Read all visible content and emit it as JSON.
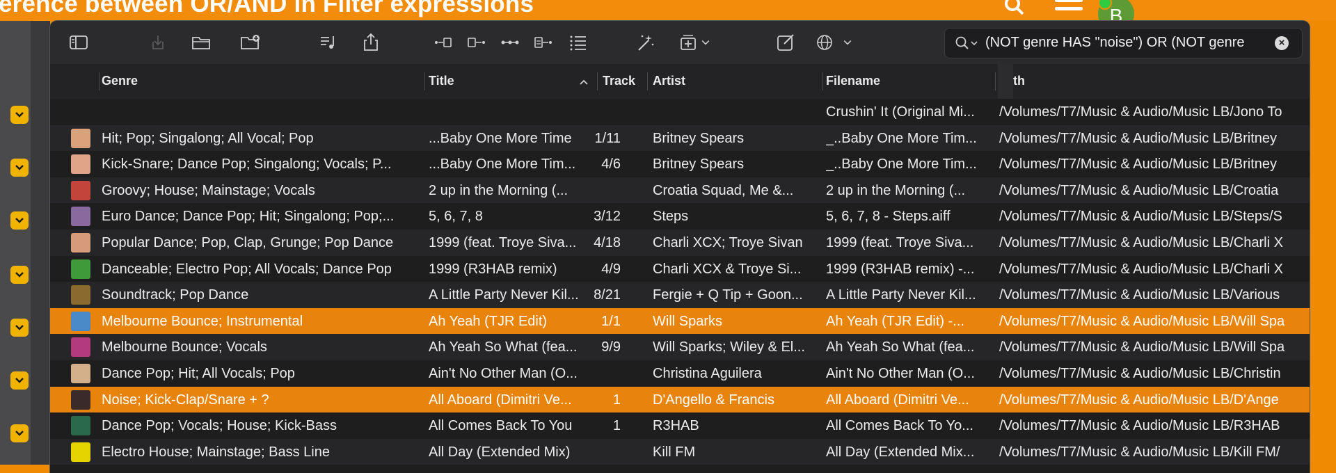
{
  "page": {
    "title": "erence between OR/AND in Filter expressions",
    "avatar_letter": "B"
  },
  "search": {
    "value": "(NOT genre HAS \"noise\") OR (NOT genre",
    "clear": "×"
  },
  "columns": {
    "genre": "Genre",
    "title": "Title",
    "track": "Track",
    "artist": "Artist",
    "filename": "Filename",
    "path": "th"
  },
  "rows": [
    {
      "genre": "",
      "title": "",
      "track": "",
      "artist": "",
      "filename": "Crushin' It (Original Mi...",
      "path": "/Volumes/T7/Music & Audio/Music LB/Jono To",
      "thumb": "",
      "style": "base"
    },
    {
      "genre": "Hit; Pop; Singalong; All Vocal; Pop",
      "title": "...Baby One More Time",
      "track": "1/11",
      "artist": "Britney Spears",
      "filename": "_..Baby One More Tim...",
      "path": "/Volumes/T7/Music & Audio/Music LB/Britney",
      "thumb": "#d9a27a",
      "style": "alt"
    },
    {
      "genre": "Kick-Snare; Dance Pop; Singalong; Vocals; P...",
      "title": "...Baby One More Tim...",
      "track": "4/6",
      "artist": "Britney Spears",
      "filename": "_..Baby One More Tim...",
      "path": "/Volumes/T7/Music & Audio/Music LB/Britney",
      "thumb": "#e0a488",
      "style": "base"
    },
    {
      "genre": "Groovy; House; Mainstage; Vocals",
      "title": "2 up in the Morning (...",
      "track": "",
      "artist": "Croatia Squad, Me &...",
      "filename": "2 up in the Morning (...",
      "path": "/Volumes/T7/Music & Audio/Music LB/Croatia",
      "thumb": "#c2443a",
      "style": "alt"
    },
    {
      "genre": "Euro Dance; Dance Pop; Hit; Singalong; Pop;...",
      "title": "5, 6, 7, 8",
      "track": "3/12",
      "artist": "Steps",
      "filename": "5, 6, 7, 8 - Steps.aiff",
      "path": "/Volumes/T7/Music & Audio/Music LB/Steps/S",
      "thumb": "#8a6a9e",
      "style": "base"
    },
    {
      "genre": "Popular Dance; Pop, Clap, Grunge; Pop Dance",
      "title": "1999 (feat. Troye Siva...",
      "track": "4/18",
      "artist": "Charli XCX; Troye Sivan",
      "filename": "1999 (feat. Troye Siva...",
      "path": "/Volumes/T7/Music & Audio/Music LB/Charli X",
      "thumb": "#d79a7a",
      "style": "alt"
    },
    {
      "genre": "Danceable; Electro Pop; All Vocals; Dance Pop",
      "title": "1999 (R3HAB remix)",
      "track": "4/9",
      "artist": "Charli XCX & Troye Si...",
      "filename": "1999 (R3HAB remix) -...",
      "path": "/Volumes/T7/Music & Audio/Music LB/Charli X",
      "thumb": "#3f9b3a",
      "style": "base"
    },
    {
      "genre": "Soundtrack; Pop Dance",
      "title": "A Little Party Never Kil...",
      "track": "8/21",
      "artist": "Fergie + Q Tip + Goon...",
      "filename": "A Little Party Never Kil...",
      "path": "/Volumes/T7/Music & Audio/Music LB/Various",
      "thumb": "#8a6a2e",
      "style": "alt"
    },
    {
      "genre": "Melbourne Bounce; Instrumental",
      "title": "Ah Yeah (TJR Edit)",
      "track": "1/1",
      "artist": "Will Sparks",
      "filename": "Ah Yeah (TJR Edit) -...",
      "path": "/Volumes/T7/Music & Audio/Music LB/Will Spa",
      "thumb": "#4a8ac8",
      "style": "sel"
    },
    {
      "genre": "Melbourne Bounce; Vocals",
      "title": "Ah Yeah So What (fea...",
      "track": "9/9",
      "artist": "Will Sparks; Wiley & El...",
      "filename": "Ah Yeah So What (fea...",
      "path": "/Volumes/T7/Music & Audio/Music LB/Will Spa",
      "thumb": "#b43a7e",
      "style": "alt"
    },
    {
      "genre": "Dance Pop; Hit; All Vocals; Pop",
      "title": "Ain't No Other Man (O...",
      "track": "",
      "artist": "Christina Aguilera",
      "filename": "Ain't No Other Man (O...",
      "path": "/Volumes/T7/Music & Audio/Music LB/Christin",
      "thumb": "#d4b08a",
      "style": "base"
    },
    {
      "genre": "Noise; Kick-Clap/Snare + ?",
      "title": "All Aboard (Dimitri Ve...",
      "track": "1",
      "artist": "D'Angello & Francis",
      "filename": "All Aboard (Dimitri Ve...",
      "path": "/Volumes/T7/Music & Audio/Music LB/D'Ange",
      "thumb": "#3a2a2a",
      "style": "sel"
    },
    {
      "genre": "Dance Pop; Vocals; House; Kick-Bass",
      "title": "All Comes Back To You",
      "track": "1",
      "artist": "R3HAB",
      "filename": "All Comes Back To Yo...",
      "path": "/Volumes/T7/Music & Audio/Music LB/R3HAB",
      "thumb": "#2a6a4a",
      "style": "base"
    },
    {
      "genre": "Electro House; Mainstage; Bass Line",
      "title": "All Day (Extended Mix)",
      "track": "",
      "artist": "Kill FM",
      "filename": "All Day (Extended Mix...",
      "path": "/Volumes/T7/Music & Audio/Music LB/Kill FM/",
      "thumb": "#e6d400",
      "style": "alt"
    }
  ],
  "colors": {
    "accent": "#e8830c",
    "header_orange": "#f28c0a",
    "dropdown_yellow": "#f0b400"
  },
  "icons": [
    "sidebar-icon",
    "import-icon",
    "folder-icon",
    "folder-add-icon",
    "playlist-icon",
    "share-icon",
    "action-icon",
    "magic-icon",
    "stack-icon",
    "edit-icon",
    "globe-icon",
    "search-icon"
  ]
}
